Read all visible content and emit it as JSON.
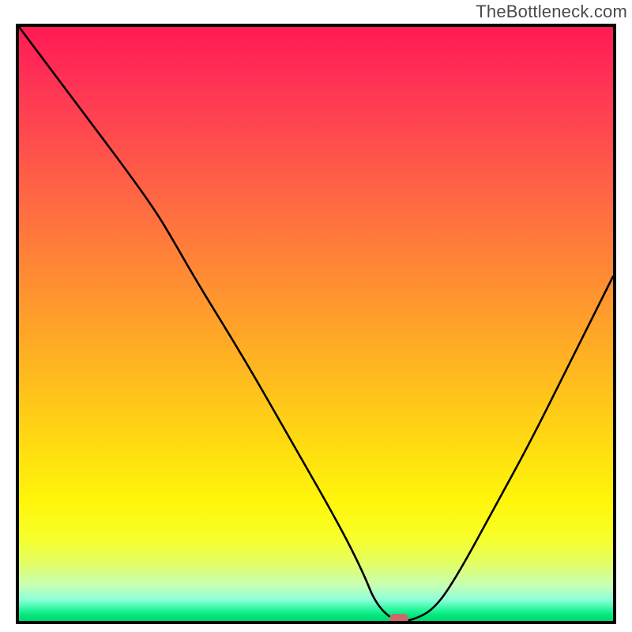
{
  "watermark": "TheBottleneck.com",
  "chart_data": {
    "type": "line",
    "title": "",
    "xlabel": "",
    "ylabel": "",
    "xlim": [
      0,
      100
    ],
    "ylim": [
      0,
      100
    ],
    "grid": false,
    "legend": false,
    "background": "gradient-red-to-green-vertical",
    "series": [
      {
        "name": "curve",
        "x": [
          0,
          6,
          12,
          18,
          23,
          26,
          30,
          38,
          46,
          54,
          58,
          60,
          63,
          66,
          70,
          74,
          80,
          86,
          92,
          98,
          100
        ],
        "y": [
          100,
          92,
          84,
          76,
          69,
          64,
          57,
          44,
          30,
          16,
          8,
          3,
          0,
          0,
          2,
          8,
          19,
          30,
          42,
          54,
          58
        ]
      }
    ],
    "marker": {
      "x": 64,
      "y": 0,
      "shape": "rounded-rect",
      "color": "#c96b6b"
    },
    "note": "Values estimated from pixel positions; y=0 is the bottom of the plot, y=100 is the top."
  }
}
